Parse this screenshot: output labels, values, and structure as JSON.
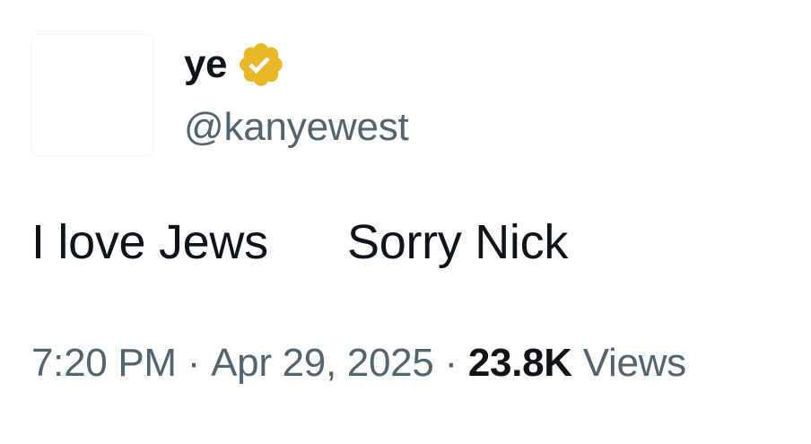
{
  "author": {
    "display_name": "ye",
    "handle": "@kanyewest",
    "verified_icon": "verified-badge-icon",
    "badge_color": "#E8B829"
  },
  "tweet": {
    "text": "I love Jews      Sorry Nick"
  },
  "meta": {
    "time": "7:20 PM",
    "separator": "·",
    "date": "Apr 29, 2025",
    "views_count": "23.8K",
    "views_label": "Views"
  }
}
